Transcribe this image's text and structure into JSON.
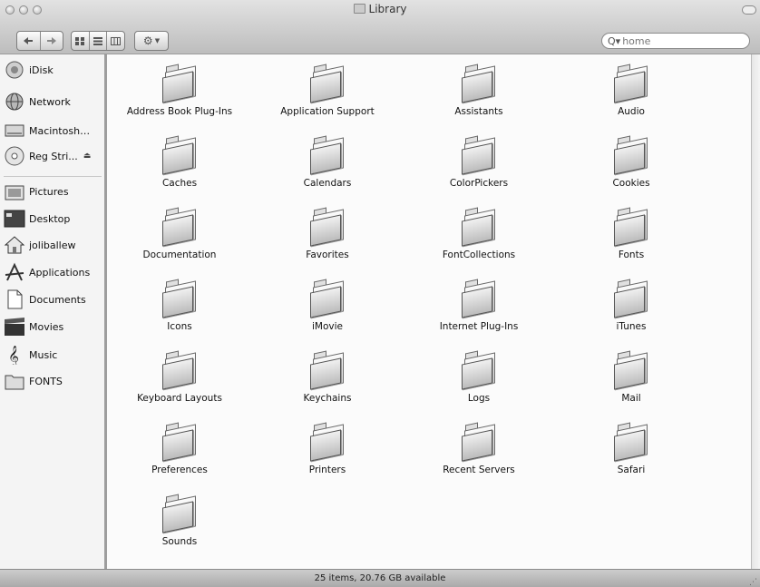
{
  "window": {
    "title": "Library",
    "search": {
      "value": "home",
      "placeholder": ""
    },
    "status": "25 items, 20.76 GB available"
  },
  "toolbar": {
    "back_icon": "back-arrow-icon",
    "forward_icon": "forward-arrow-icon",
    "view_icons": [
      "icon-view-icon",
      "list-view-icon",
      "column-view-icon"
    ],
    "action_icon": "gear-icon"
  },
  "sidebar": {
    "devices": [
      {
        "label": "iDisk",
        "icon": "idisk-icon"
      },
      {
        "label": "Network",
        "icon": "network-icon"
      },
      {
        "label": "Macintosh ...",
        "icon": "hard-drive-icon"
      },
      {
        "label": "Reg Stri...",
        "icon": "cd-icon",
        "eject": "⏏"
      }
    ],
    "places": [
      {
        "label": "Pictures",
        "icon": "pictures-folder-icon"
      },
      {
        "label": "Desktop",
        "icon": "desktop-icon"
      },
      {
        "label": "joliballew",
        "icon": "home-icon"
      },
      {
        "label": "Applications",
        "icon": "applications-icon"
      },
      {
        "label": "Documents",
        "icon": "documents-icon"
      },
      {
        "label": "Movies",
        "icon": "movies-icon"
      },
      {
        "label": "Music",
        "icon": "music-icon"
      },
      {
        "label": "FONTS",
        "icon": "folder-icon"
      }
    ]
  },
  "folders": [
    "Address Book Plug-Ins",
    "Application Support",
    "Assistants",
    "Audio",
    "Caches",
    "Calendars",
    "ColorPickers",
    "Cookies",
    "Documentation",
    "Favorites",
    "FontCollections",
    "Fonts",
    "Icons",
    "iMovie",
    "Internet Plug-Ins",
    "iTunes",
    "Keyboard Layouts",
    "Keychains",
    "Logs",
    "Mail",
    "Preferences",
    "Printers",
    "Recent Servers",
    "Safari",
    "Sounds"
  ]
}
